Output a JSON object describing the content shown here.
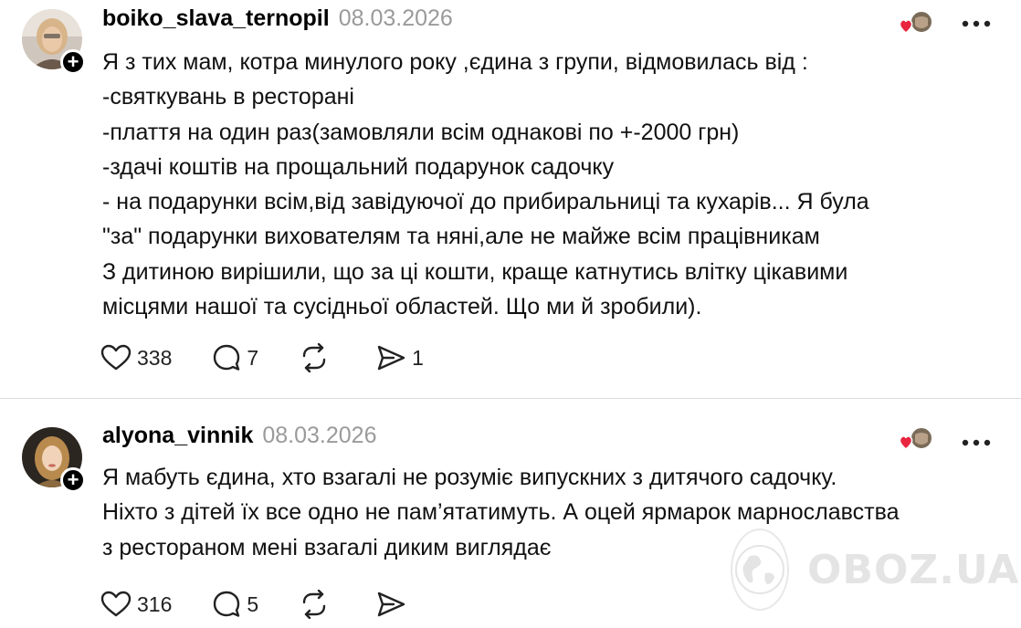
{
  "posts": [
    {
      "username": "boiko_slava_ternopil",
      "date": "08.03.2026",
      "avatar_icon": "profile-photo-woman-blonde",
      "follow_badge": "+",
      "text_lines": [
        "Я з тих мам, котра минулого року ,єдина з групи, відмовилась від :",
        "-святкувань в ресторані",
        "-плаття на один раз(замовляли всім однакові по +-2000 грн)",
        "-здачі коштів на прощальний подарунок садочку",
        "- на подарунки всім,від завідуючої до прибиральниці та кухарів... Я була",
        "\"за\" подарунки вихователям та няні,але не майже всім працівникам",
        "З дитиною вирішили, що за ці кошти, краще катнутись влітку цікавими",
        "місцями нашої та сусідньої областей. Що ми й зробили)."
      ],
      "likes": "338",
      "comments": "7",
      "reposts": "",
      "shares": "1"
    },
    {
      "username": "alyona_vinnik",
      "date": "08.03.2026",
      "avatar_icon": "profile-photo-woman-blonde-dark",
      "follow_badge": "+",
      "text_lines": [
        "Я мабуть єдина, хто взагалі не розуміє випускних з дитячого садочку.",
        "Ніхто з дітей їх все одно не пам’ятатимуть. А оцей ярмарок марнославства",
        "з рестораном мені взагалі диким виглядає"
      ],
      "likes": "316",
      "comments": "5",
      "reposts": "",
      "shares": ""
    }
  ],
  "watermark": "OBOZ.UA",
  "colors": {
    "heart_red": "#e8263f",
    "muted_gray": "#9a9a9a",
    "divider": "#dcdcdc"
  }
}
